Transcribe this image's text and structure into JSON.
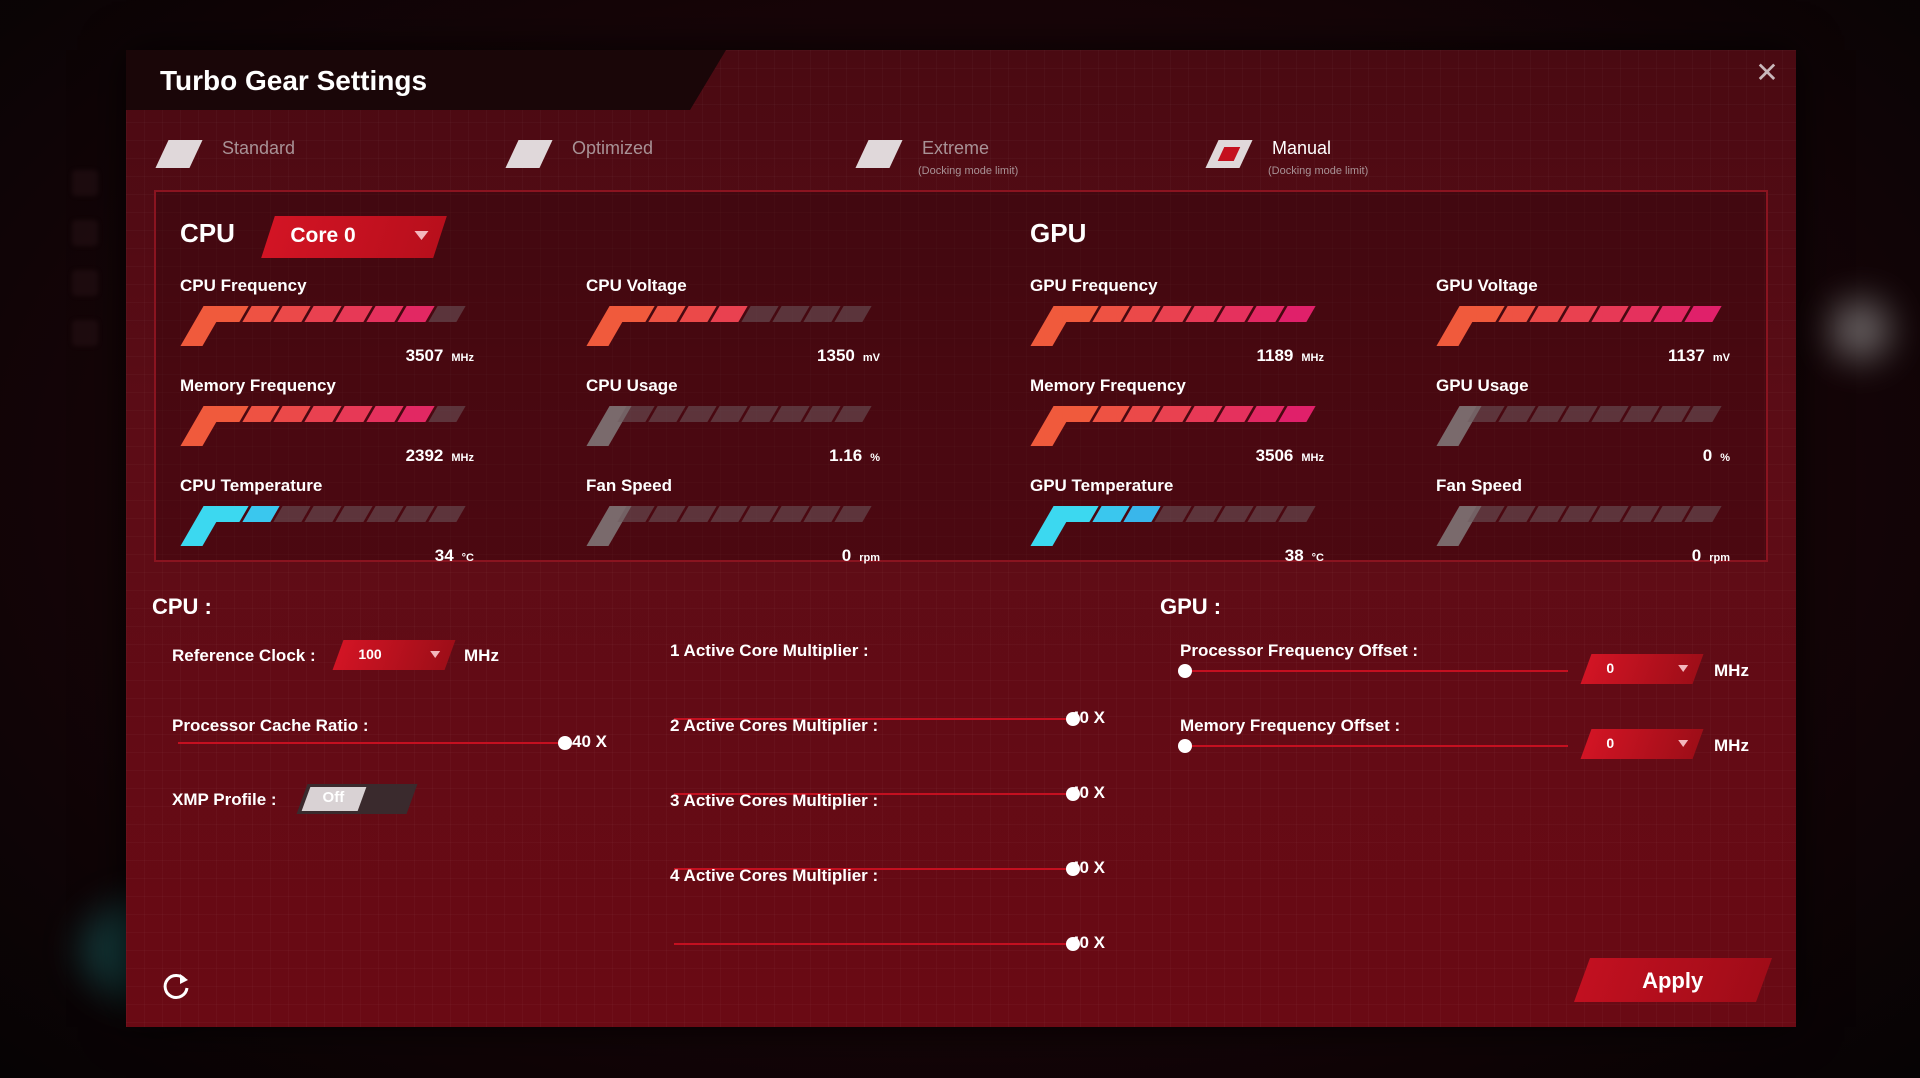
{
  "window": {
    "title": "Turbo Gear Settings"
  },
  "modes": [
    {
      "label": "Standard",
      "sub": "",
      "selected": false
    },
    {
      "label": "Optimized",
      "sub": "",
      "selected": false
    },
    {
      "label": "Extreme",
      "sub": "(Docking mode limit)",
      "selected": false
    },
    {
      "label": "Manual",
      "sub": "(Docking mode limit)",
      "selected": true
    }
  ],
  "monitor": {
    "cpu_title": "CPU",
    "gpu_title": "GPU",
    "core_select": "Core 0",
    "gauges": {
      "cpu_freq": {
        "label": "CPU Frequency",
        "value": "3507",
        "unit": "MHz",
        "level": 0.85,
        "theme": "hot"
      },
      "cpu_volt": {
        "label": "CPU Voltage",
        "value": "1350",
        "unit": "mV",
        "level": 0.45,
        "theme": "hot"
      },
      "cpu_mem": {
        "label": "Memory Frequency",
        "value": "2392",
        "unit": "MHz",
        "level": 0.85,
        "theme": "hot"
      },
      "cpu_usage": {
        "label": "CPU Usage",
        "value": "1.16",
        "unit": "%",
        "level": 0.05,
        "theme": "idle"
      },
      "cpu_temp": {
        "label": "CPU Temperature",
        "value": "34",
        "unit": "°C",
        "level": 0.3,
        "theme": "cool"
      },
      "cpu_fan": {
        "label": "Fan Speed",
        "value": "0",
        "unit": "rpm",
        "level": 0.0,
        "theme": "idle"
      },
      "gpu_freq": {
        "label": "GPU Frequency",
        "value": "1189",
        "unit": "MHz",
        "level": 0.98,
        "theme": "hot"
      },
      "gpu_volt": {
        "label": "GPU Voltage",
        "value": "1137",
        "unit": "mV",
        "level": 0.98,
        "theme": "hot"
      },
      "gpu_mem": {
        "label": "Memory Frequency",
        "value": "3506",
        "unit": "MHz",
        "level": 1.0,
        "theme": "hot"
      },
      "gpu_usage": {
        "label": "GPU Usage",
        "value": "0",
        "unit": "%",
        "level": 0.0,
        "theme": "idle"
      },
      "gpu_temp": {
        "label": "GPU Temperature",
        "value": "38",
        "unit": "°C",
        "level": 0.35,
        "theme": "cool"
      },
      "gpu_fan": {
        "label": "Fan Speed",
        "value": "0",
        "unit": "rpm",
        "level": 0.0,
        "theme": "idle"
      }
    }
  },
  "cpu_settings": {
    "title": "CPU :",
    "ref_clock_label": "Reference Clock :",
    "ref_clock_value": "100",
    "ref_clock_unit": "MHz",
    "cache_ratio_label": "Processor Cache Ratio :",
    "cache_ratio_value": "40 X",
    "cache_ratio_level": 1.0,
    "xmp_label": "XMP Profile :",
    "xmp_value": "Off",
    "multipliers": [
      {
        "label": "1 Active Core Multiplier :",
        "value": "40 X",
        "level": 1.0
      },
      {
        "label": "2 Active Cores Multiplier :",
        "value": "40 X",
        "level": 1.0
      },
      {
        "label": "3 Active Cores Multiplier :",
        "value": "40 X",
        "level": 1.0
      },
      {
        "label": "4 Active Cores Multiplier :",
        "value": "40 X",
        "level": 1.0
      }
    ]
  },
  "gpu_settings": {
    "title": "GPU :",
    "proc_offset_label": "Processor Frequency Offset :",
    "proc_offset_value": "0",
    "proc_offset_level": 0.0,
    "proc_offset_unit": "MHz",
    "mem_offset_label": "Memory Frequency Offset :",
    "mem_offset_value": "0",
    "mem_offset_level": 0.0,
    "mem_offset_unit": "MHz"
  },
  "footer": {
    "apply_label": "Apply",
    "reset_icon": "refresh-icon"
  },
  "colors": {
    "accent": "#c4101e",
    "hot_start": "#f05a3c",
    "hot_end": "#e0206a",
    "cool_start": "#3cd8f0",
    "cool_end": "#3060e0",
    "idle": "#6a5a5c"
  }
}
